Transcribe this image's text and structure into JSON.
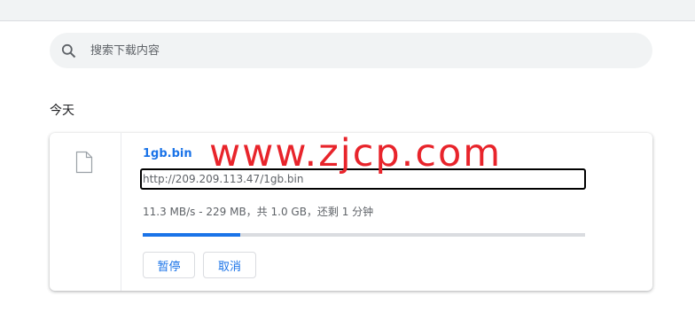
{
  "search": {
    "placeholder": "搜索下载内容"
  },
  "section_title": "今天",
  "download": {
    "file_name": "1gb.bin",
    "url": "http://209.209.113.47/1gb.bin",
    "status": "11.3 MB/s - 229 MB，共 1.0 GB，还剩 1 分钟",
    "progress_fraction": 0.22,
    "pause_label": "暂停",
    "cancel_label": "取消"
  },
  "watermark": "www.zjcp.com",
  "colors": {
    "accent": "#1a73e8",
    "watermark": "#e8242b"
  },
  "icons": {
    "search": "search-icon",
    "file": "file-icon"
  }
}
